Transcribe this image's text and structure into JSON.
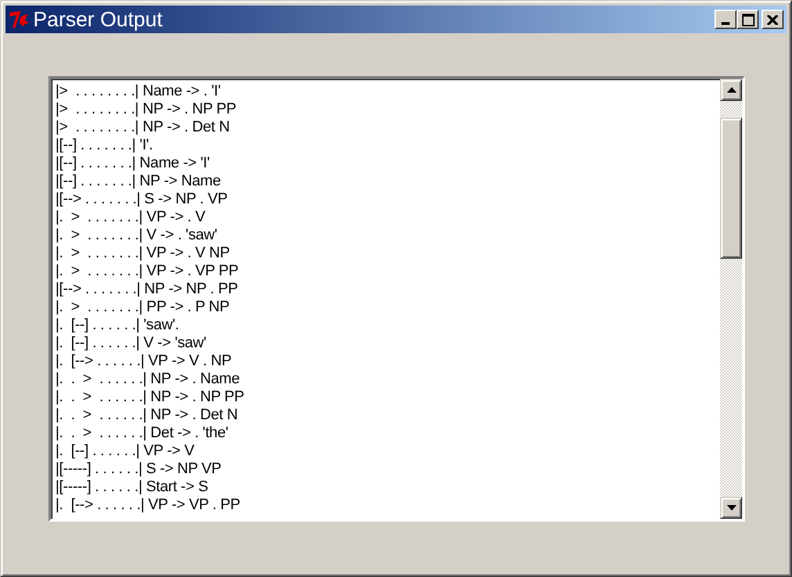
{
  "window": {
    "title": "Parser Output"
  },
  "lines": [
    "|>  . . . . . . . .| Name -> . 'I'",
    "|>  . . . . . . . .| NP -> . NP PP",
    "|>  . . . . . . . .| NP -> . Det N",
    "|[--] . . . . . . .| 'I'.",
    "|[--] . . . . . . .| Name -> 'I'",
    "|[--] . . . . . . .| NP -> Name",
    "|[--> . . . . . . .| S -> NP . VP",
    "|.  >  . . . . . . .| VP -> . V",
    "|.  >  . . . . . . .| V -> . 'saw'",
    "|.  >  . . . . . . .| VP -> . V NP",
    "|.  >  . . . . . . .| VP -> . VP PP",
    "|[--> . . . . . . .| NP -> NP . PP",
    "|.  >  . . . . . . .| PP -> . P NP",
    "|.  [--] . . . . . .| 'saw'.",
    "|.  [--] . . . . . .| V -> 'saw'",
    "|.  [--> . . . . . .| VP -> V . NP",
    "|.  .  >  . . . . . .| NP -> . Name",
    "|.  .  >  . . . . . .| NP -> . NP PP",
    "|.  .  >  . . . . . .| NP -> . Det N",
    "|.  .  >  . . . . . .| Det -> . 'the'",
    "|.  [--] . . . . . .| VP -> V",
    "|[-----] . . . . . .| S -> NP VP",
    "|[-----] . . . . . .| Start -> S",
    "|.  [--> . . . . . .| VP -> VP . PP"
  ]
}
